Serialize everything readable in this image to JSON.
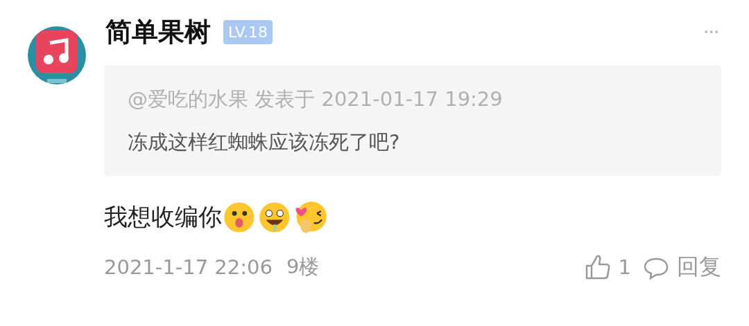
{
  "comment": {
    "author": "简单果树",
    "level_badge": "LV.18",
    "more": "···",
    "quote": {
      "header": "@爱吃的水果 发表于 2021-01-17 19:29",
      "text": "冻成这样红蜘蛛应该冻死了吧?"
    },
    "text": "我想收编你",
    "emojis": [
      {
        "kind": "tongue"
      },
      {
        "kind": "drool"
      },
      {
        "kind": "heart"
      }
    ],
    "time": "2021-1-17 22:06",
    "floor": "9楼",
    "likes": "1",
    "reply": "回复"
  }
}
